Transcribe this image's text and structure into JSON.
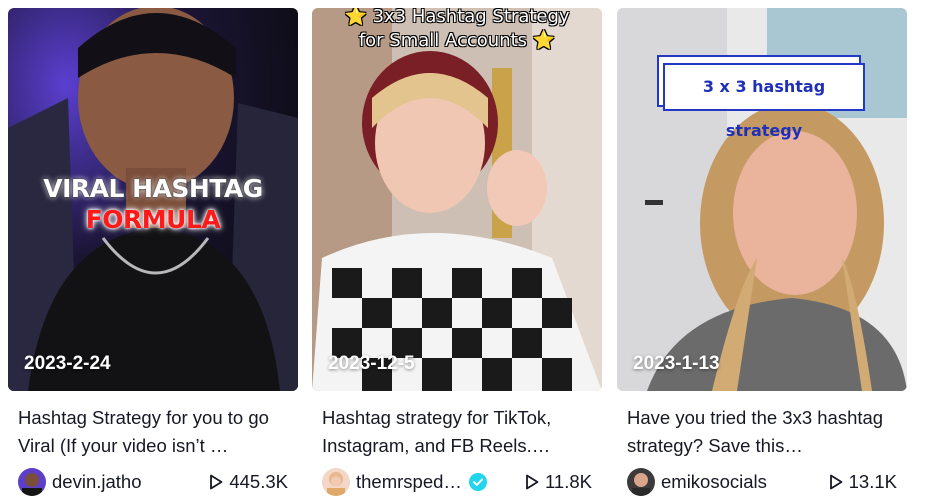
{
  "videos": [
    {
      "date": "2023-2-24",
      "caption": "Hashtag Strategy for you to go Viral (If your video isn’t …",
      "username": "devin.jatho",
      "verified": false,
      "views": "445.3K",
      "overlay_line1": "VIRAL HASHTAG",
      "overlay_line2": "FORMULA"
    },
    {
      "date": "2023-12-5",
      "caption": "Hashtag strategy for TikTok, Instagram, and FB Reels.…",
      "username": "themrsped…",
      "verified": true,
      "views": "11.8K",
      "overlay_line1": "⭐ 3x3 Hashtag Strategy",
      "overlay_line2": "for Small Accounts ⭐"
    },
    {
      "date": "2023-1-13",
      "caption": "Have you tried the 3x3 hashtag strategy? Save this…",
      "username": "emikosocials",
      "verified": false,
      "views": "13.1K",
      "overlay_line1": "3 x 3 hashtag strategy"
    }
  ],
  "colors": {
    "text": "#161823",
    "verified_badge": "#20d5ec",
    "overlay_red": "#ff1a1a",
    "overlay_blue": "#1f30b8"
  },
  "icons": {
    "views": "play-icon",
    "verified": "verified-badge-icon"
  }
}
